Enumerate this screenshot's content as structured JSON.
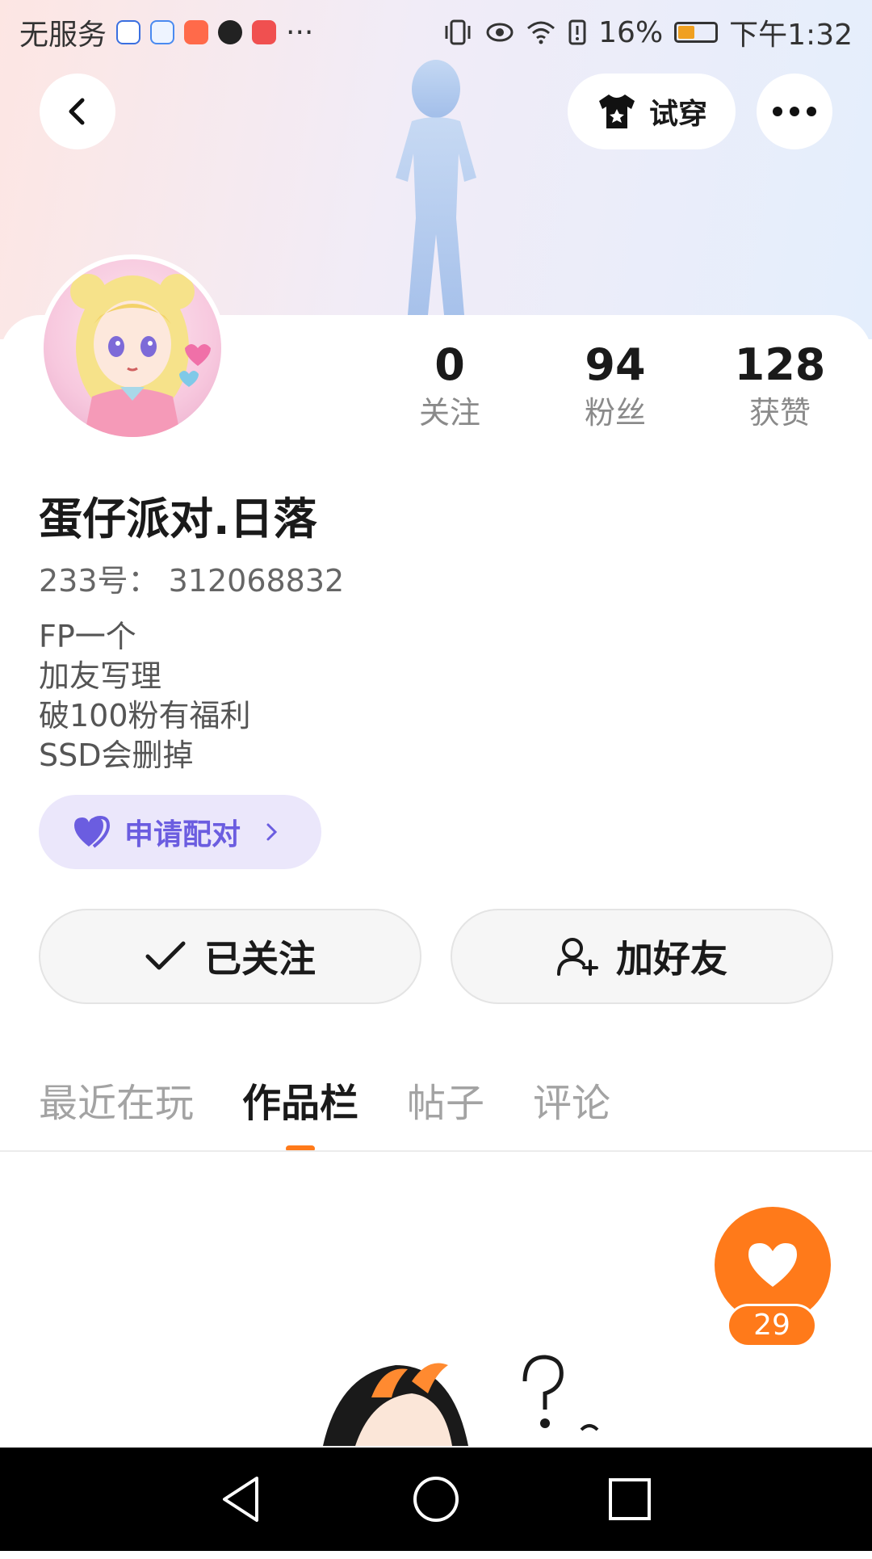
{
  "status_bar": {
    "carrier": "无服务",
    "battery": "16%",
    "time": "下午1:32"
  },
  "header": {
    "try_on_label": "试穿"
  },
  "stats": [
    {
      "value": "0",
      "label": "关注"
    },
    {
      "value": "94",
      "label": "粉丝"
    },
    {
      "value": "128",
      "label": "获赞"
    }
  ],
  "profile": {
    "username": "蛋仔派对.日落",
    "uid": "233号：  312068832",
    "bio_lines": [
      "FP一个",
      "加友写理",
      "破100粉有福利",
      "SSD会删掉"
    ]
  },
  "pair_button": {
    "label": "申请配对"
  },
  "actions": {
    "followed_label": "已关注",
    "add_friend_label": "加好友"
  },
  "tabs": [
    {
      "label": "最近在玩",
      "active": false
    },
    {
      "label": "作品栏",
      "active": true
    },
    {
      "label": "帖子",
      "active": false
    },
    {
      "label": "评论",
      "active": false
    }
  ],
  "like": {
    "count": "29"
  },
  "colors": {
    "accent": "#ff7a1a",
    "pair_bg": "#ebe7fb",
    "pair_fg": "#6b5de0"
  }
}
